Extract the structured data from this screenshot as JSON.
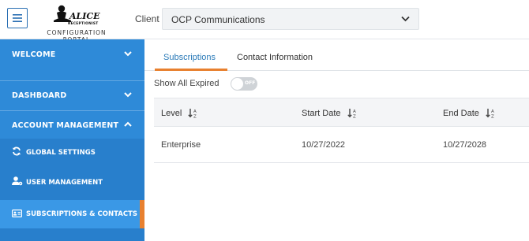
{
  "header": {
    "logo_caption": "CONFIGURATION PORTAL",
    "client_label": "Client",
    "client_value": "OCP Communications"
  },
  "sidebar": {
    "items": [
      {
        "label": "WELCOME",
        "icon": "chevron-down-icon"
      },
      {
        "label": "DASHBOARD",
        "icon": "chevron-down-icon"
      },
      {
        "label": "ACCOUNT MANAGEMENT",
        "icon": "chevron-up-icon"
      }
    ],
    "subitems": [
      {
        "label": "GLOBAL SETTINGS",
        "icon": "sync-icon"
      },
      {
        "label": "USER MANAGEMENT",
        "icon": "user-gear-icon"
      },
      {
        "label": "SUBSCRIPTIONS & CONTACTS",
        "icon": "id-card-icon",
        "active": true
      }
    ]
  },
  "tabs": [
    {
      "label": "Subscriptions",
      "active": true
    },
    {
      "label": "Contact Information",
      "active": false
    }
  ],
  "filter": {
    "show_expired_label": "Show All Expired",
    "toggle_text": "OFF",
    "toggle_on": false
  },
  "table": {
    "columns": [
      "Level",
      "Start Date",
      "End Date"
    ],
    "rows": [
      [
        "Enterprise",
        "10/27/2022",
        "10/27/2028"
      ]
    ]
  },
  "colors": {
    "sidebar": "#2e8ad8",
    "accent": "#e8802f",
    "tab_active_text": "#2a7ab8"
  }
}
